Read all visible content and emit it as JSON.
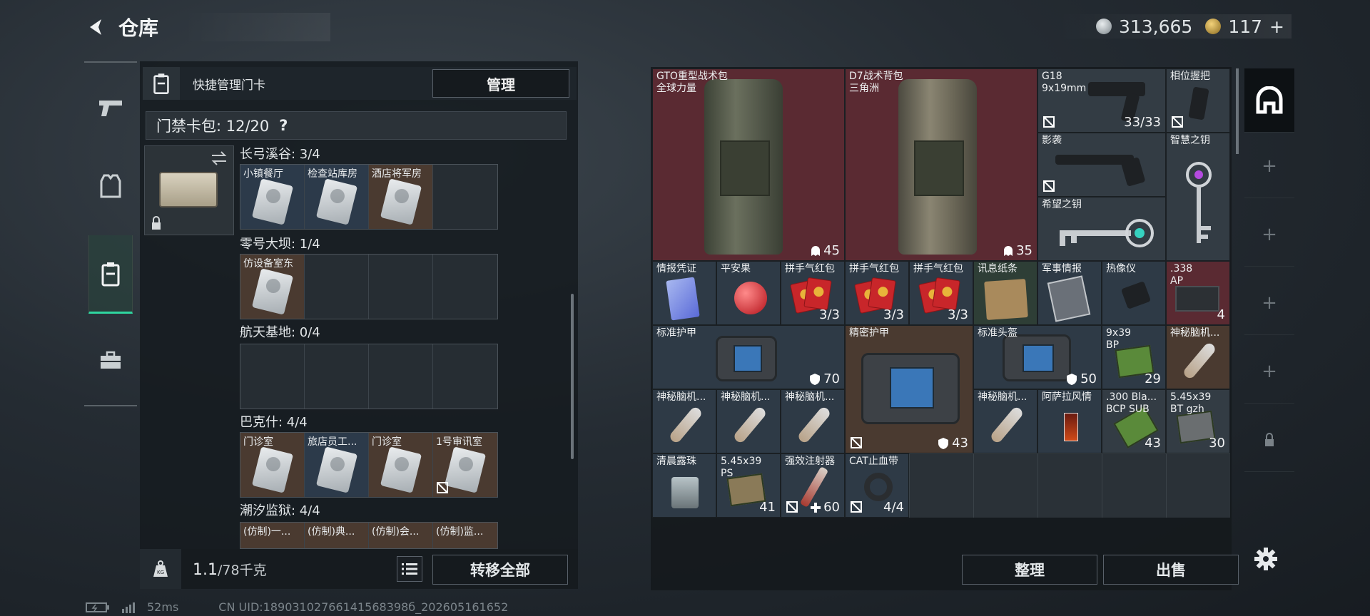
{
  "header": {
    "title": "仓库"
  },
  "currency": {
    "silver": "313,665",
    "gold": "117",
    "gold_plus": "+"
  },
  "left_rail": [
    {
      "name": "weapon-tab-icon"
    },
    {
      "name": "armor-tab-icon"
    },
    {
      "name": "keycard-tab-icon",
      "active": true
    },
    {
      "name": "toolbox-tab-icon"
    }
  ],
  "card_panel": {
    "header_label": "快捷管理门卡",
    "manage_button": "管理",
    "pack_label": "门禁卡包: 12/20",
    "help": "?",
    "regions": [
      {
        "label": "长弓溪谷: 3/4",
        "slots": [
          {
            "name": "小镇餐厅",
            "tint": "blue"
          },
          {
            "name": "检查站库房",
            "tint": "blue"
          },
          {
            "name": "酒店将军房",
            "tint": "brown"
          },
          {
            "name": "",
            "tint": "empty"
          }
        ]
      },
      {
        "label": "零号大坝: 1/4",
        "slots": [
          {
            "name": "仿设备室东",
            "tint": "brown"
          },
          {
            "name": "",
            "tint": "empty"
          },
          {
            "name": "",
            "tint": "empty"
          },
          {
            "name": "",
            "tint": "empty"
          }
        ]
      },
      {
        "label": "航天基地: 0/4",
        "slots": [
          {
            "name": "",
            "tint": "empty"
          },
          {
            "name": "",
            "tint": "empty"
          },
          {
            "name": "",
            "tint": "empty"
          },
          {
            "name": "",
            "tint": "empty"
          }
        ]
      },
      {
        "label": "巴克什: 4/4",
        "slots": [
          {
            "name": "门诊室",
            "tint": "brown"
          },
          {
            "name": "旅店员工...",
            "tint": "blue"
          },
          {
            "name": "门诊室",
            "tint": "brown"
          },
          {
            "name": "1号审讯室",
            "tint": "brown"
          }
        ]
      },
      {
        "label": "潮汐监狱: 4/4",
        "slots": [
          {
            "name": "(仿制)一...",
            "tint": "brown"
          },
          {
            "name": "(仿制)典...",
            "tint": "brown"
          },
          {
            "name": "(仿制)会...",
            "tint": "brown"
          },
          {
            "name": "(仿制)监...",
            "tint": "brown"
          }
        ]
      }
    ],
    "weight": "1.1",
    "weight_max": "/78千克",
    "transfer_button": "转移全部"
  },
  "items": [
    {
      "id": "gto",
      "name": "GTO重型战术包\n全球力量",
      "count": "45",
      "count_icon": "ghost"
    },
    {
      "id": "d7",
      "name": "D7战术背包\n三角洲",
      "count": "35",
      "count_icon": "ghost"
    },
    {
      "id": "g18",
      "name": "G18\n9x19mm",
      "count": "33/33"
    },
    {
      "id": "grip",
      "name": "相位握把",
      "count": ""
    },
    {
      "id": "shadow",
      "name": "影袭",
      "count": ""
    },
    {
      "id": "wisdom_key",
      "name": "智慧之钥",
      "count": ""
    },
    {
      "id": "hope_key",
      "name": "希望之钥",
      "count": ""
    },
    {
      "id": "intel",
      "name": "情报凭证",
      "count": ""
    },
    {
      "id": "apple",
      "name": "平安果",
      "count": ""
    },
    {
      "id": "env1",
      "name": "拼手气红包",
      "count": "3/3"
    },
    {
      "id": "env2",
      "name": "拼手气红包",
      "count": "3/3"
    },
    {
      "id": "env3",
      "name": "拼手气红包",
      "count": "3/3"
    },
    {
      "id": "note",
      "name": "讯息纸条",
      "count": ""
    },
    {
      "id": "milintel",
      "name": "军事情报",
      "count": ""
    },
    {
      "id": "thermal",
      "name": "热像仪",
      "count": ""
    },
    {
      "id": "ap338",
      "name": ".338\nAP",
      "count": "4"
    },
    {
      "id": "std_armor",
      "name": "标准护甲",
      "count": "70",
      "count_icon": "shield"
    },
    {
      "id": "precise_armor",
      "name": "精密护甲",
      "count": "43",
      "count_icon": "shield"
    },
    {
      "id": "helmet",
      "name": "标准头盔",
      "count": "50",
      "count_icon": "shield"
    },
    {
      "id": "bp939",
      "name": "9x39\nBP",
      "count": "29"
    },
    {
      "id": "myst1",
      "name": "神秘脑机...",
      "count": ""
    },
    {
      "id": "myst2",
      "name": "神秘脑机...",
      "count": ""
    },
    {
      "id": "myst3",
      "name": "神秘脑机...",
      "count": ""
    },
    {
      "id": "myst4",
      "name": "神秘脑机...",
      "count": ""
    },
    {
      "id": "myst5",
      "name": "神秘脑机...",
      "count": ""
    },
    {
      "id": "cocktail",
      "name": "阿萨拉风情",
      "count": ""
    },
    {
      "id": "blk300",
      "name": ".300 Bla...\nBCP SUB",
      "count": "43"
    },
    {
      "id": "btp545",
      "name": "5.45x39\nBT gzh",
      "count": "30"
    },
    {
      "id": "dew",
      "name": "清晨露珠",
      "count": ""
    },
    {
      "id": "ps545",
      "name": "5.45x39\nPS",
      "count": "41"
    },
    {
      "id": "injector",
      "name": "强效注射器",
      "count": "60",
      "count_icon": "plus"
    },
    {
      "id": "cat",
      "name": "CAT止血带",
      "count": "4/4"
    }
  ],
  "bottom_buttons": {
    "sort": "整理",
    "sell": "出售"
  },
  "status": {
    "ping": "52ms",
    "uid": "CN UID:18903102766141568398б_202605161652"
  }
}
